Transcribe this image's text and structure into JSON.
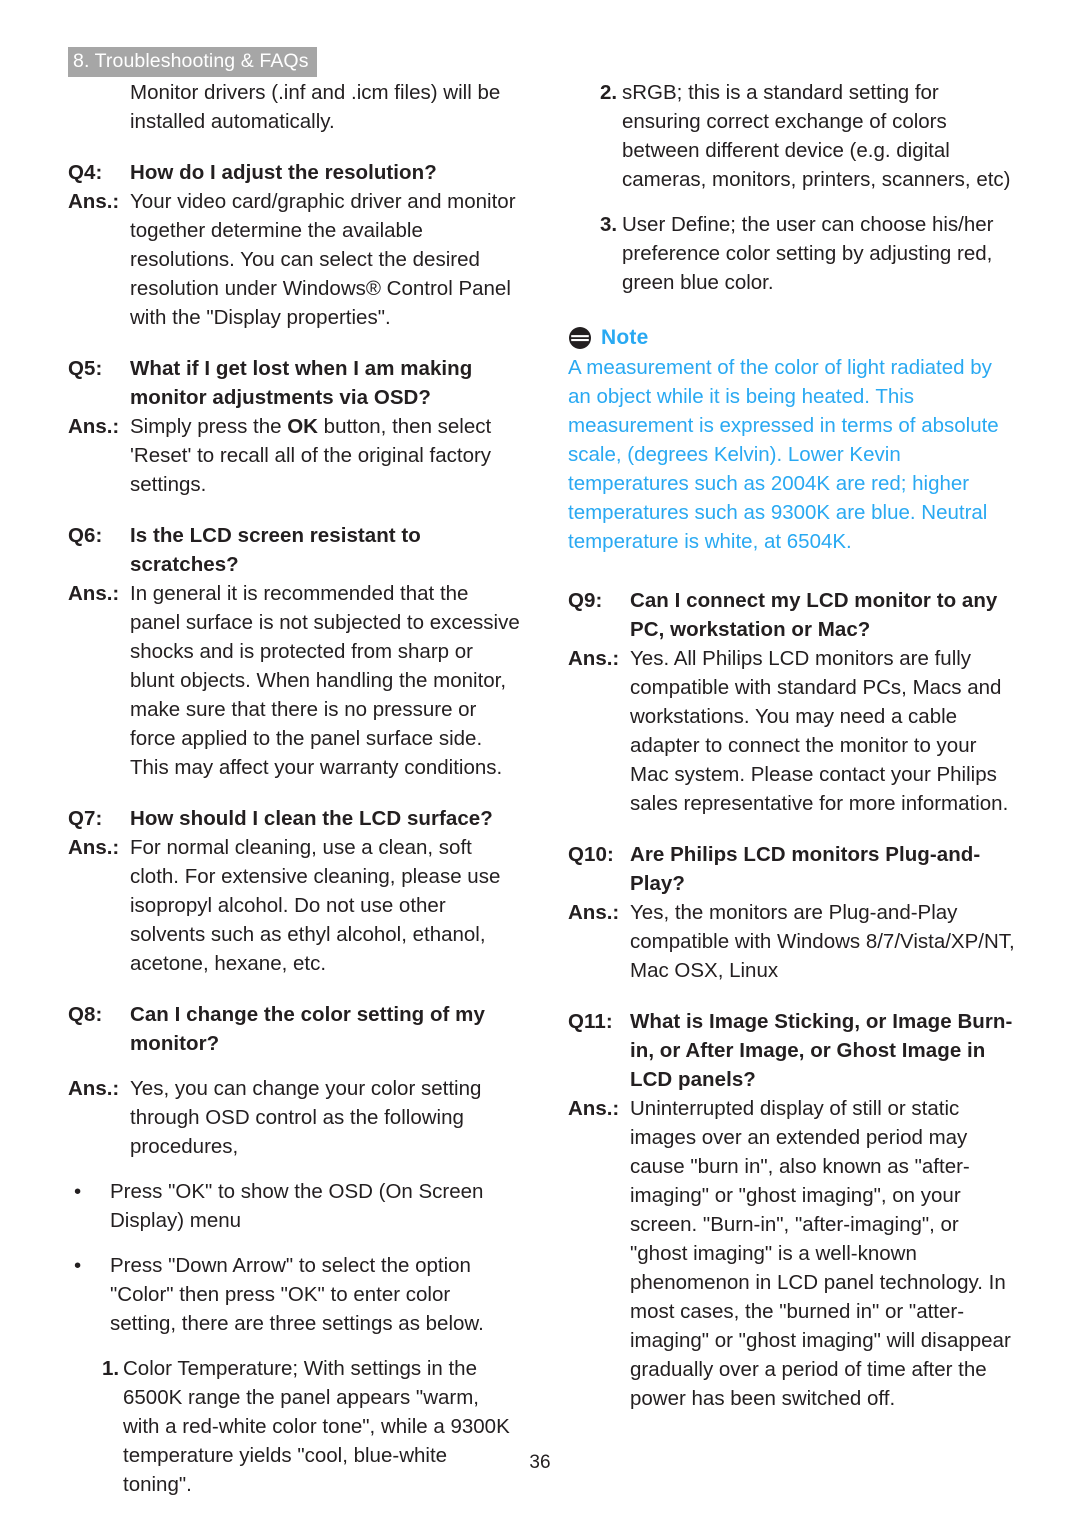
{
  "header": {
    "section_label": "8. Troubleshooting & FAQs"
  },
  "page_number": "36",
  "colors": {
    "header_badge_bg": "#a6a6a6",
    "header_badge_text": "#ffffff",
    "body_text": "#231f20",
    "note_accent": "#29a9f2"
  },
  "labels": {
    "ans": "Ans.:",
    "bullet": "•"
  },
  "left_column": [
    {
      "type": "continuation",
      "text": "Monitor drivers (.inf and .icm files) will be installed automatically."
    },
    {
      "type": "qa",
      "q_label": "Q4:",
      "question": "How do I adjust the resolution?",
      "answer": "Your video card/graphic driver and monitor together determine the available resolutions. You can select the desired resolution under Windows® Control Panel with the \"Display properties\"."
    },
    {
      "type": "qa",
      "q_label": "Q5:",
      "question": "What if I get lost when I am making monitor adjustments via OSD?",
      "answer_parts": [
        {
          "text": "Simply press the ",
          "bold": false
        },
        {
          "text": "OK",
          "bold": true
        },
        {
          "text": " button, then select 'Reset' to recall all of the original factory settings.",
          "bold": false
        }
      ]
    },
    {
      "type": "qa",
      "q_label": "Q6:",
      "question": "Is the LCD screen resistant to scratches?",
      "answer": "In general it is recommended that the panel surface is not subjected to excessive shocks and is protected from sharp or blunt objects. When handling the monitor, make sure that there is no pressure or force applied to the panel surface side. This may affect your warranty conditions."
    },
    {
      "type": "qa",
      "q_label": "Q7:",
      "question": "How should I clean the LCD surface?",
      "answer": "For normal cleaning, use a clean, soft cloth. For extensive cleaning, please use isopropyl alcohol. Do not use other solvents such as ethyl alcohol, ethanol, acetone, hexane, etc."
    },
    {
      "type": "qa",
      "q_label": "Q8:",
      "question": "Can I change the color setting of my monitor?",
      "answer": "Yes, you can change your color setting through OSD control as the following procedures,",
      "bullets": [
        "Press \"OK\" to show the OSD (On Screen Display) menu",
        "Press \"Down Arrow\" to select the option \"Color\" then press \"OK\" to enter color setting, there are three settings as below."
      ],
      "numbered": [
        {
          "marker": "1.",
          "text": "Color Temperature; With settings in the 6500K range the panel appears \"warm, with a red-white color tone\", while a 9300K temperature yields \"cool, blue-white toning\"."
        }
      ]
    }
  ],
  "right_column": {
    "numbered_continued": [
      {
        "marker": "2.",
        "text": "sRGB; this is a standard setting for ensuring correct exchange of colors between different device (e.g. digital cameras, monitors, printers, scanners, etc)"
      },
      {
        "marker": "3.",
        "text": "User Define; the user can choose his/her preference color setting by adjusting red, green blue color."
      }
    ],
    "note": {
      "title": "Note",
      "icon": "note-circle-icon",
      "text": "A measurement of the color of light radiated by an object while it is being heated. This measurement is expressed in terms of absolute scale, (degrees Kelvin). Lower Kevin temperatures such as 2004K are red; higher temperatures such as 9300K are blue. Neutral temperature is white, at 6504K."
    },
    "qa": [
      {
        "q_label": "Q9:",
        "question": "Can I connect my LCD monitor to any PC, workstation or Mac?",
        "answer": "Yes. All Philips LCD monitors are fully compatible with standard PCs, Macs and workstations. You may need a cable adapter to connect the monitor to your Mac system. Please contact your Philips sales representative for more information."
      },
      {
        "q_label": "Q10:",
        "question": "Are Philips LCD monitors Plug-and-Play?",
        "answer": "Yes, the monitors are Plug-and-Play compatible with Windows 8/7/Vista/XP/NT, Mac OSX, Linux"
      },
      {
        "q_label": "Q11:",
        "question": "What is Image Sticking, or Image Burn-in, or After Image, or Ghost Image in LCD panels?",
        "answer": "Uninterrupted display of still or static images over an extended period may cause \"burn in\", also known as \"after-imaging\" or \"ghost imaging\", on your screen. \"Burn-in\", \"after-imaging\", or \"ghost imaging\" is a well-known phenomenon in LCD panel technology. In most cases, the \"burned in\" or \"atter-imaging\" or \"ghost imaging\" will disappear gradually over a period of time after the power has been switched off."
      }
    ]
  }
}
